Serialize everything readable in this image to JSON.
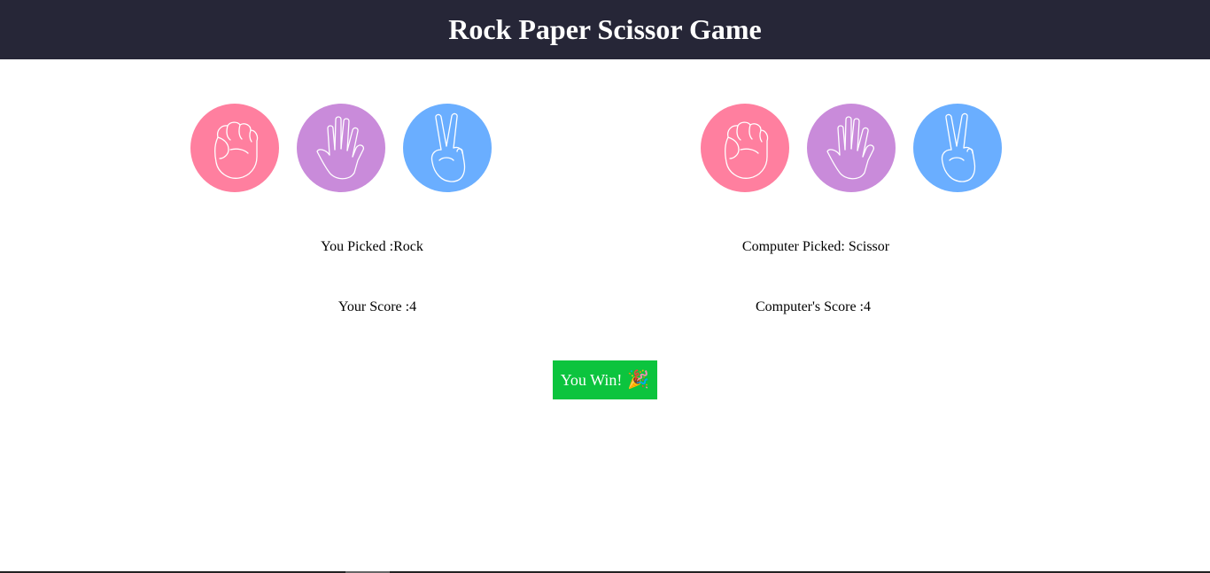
{
  "header": {
    "title": "Rock Paper Scissor Game"
  },
  "colors": {
    "header_bg": "#262637",
    "rock": "#ff7f9f",
    "paper": "#c98bda",
    "scissor": "#6aaeff",
    "win_button": "#0cc43e"
  },
  "player": {
    "choices": [
      {
        "name": "Rock",
        "icon": "fist-icon"
      },
      {
        "name": "Paper",
        "icon": "open-hand-icon"
      },
      {
        "name": "Scissor",
        "icon": "peace-hand-icon"
      }
    ],
    "picked_label": "You Picked :Rock",
    "score_label": "Your Score :4"
  },
  "computer": {
    "choices": [
      {
        "name": "Rock",
        "icon": "fist-icon"
      },
      {
        "name": "Paper",
        "icon": "open-hand-icon"
      },
      {
        "name": "Scissor",
        "icon": "peace-hand-icon"
      }
    ],
    "picked_label": "Computer Picked: Scissor",
    "score_label": "Computer's Score :4"
  },
  "result": {
    "label": "You Win!",
    "emoji": "🎉"
  }
}
